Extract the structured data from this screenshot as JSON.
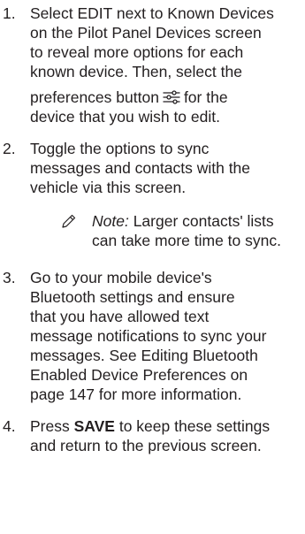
{
  "steps": [
    {
      "number": "1.",
      "lines": [
        "Select EDIT next to Known Devices",
        "on the Pilot Panel Devices screen",
        "to reveal more options for each",
        "known device. Then, select the"
      ],
      "line5_before": "preferences button",
      "line5_after": "for the",
      "line6": "device that you wish to edit."
    },
    {
      "number": "2.",
      "lines": [
        "Toggle the options to sync",
        "messages and contacts with the",
        "vehicle via this screen."
      ]
    },
    {
      "number": "3.",
      "lines": [
        "Go to your mobile device's",
        "Bluetooth settings and ensure",
        "that you have allowed text",
        "message notifications to sync your",
        "messages. See Editing Bluetooth",
        "Enabled Device Preferences on",
        "page 147 for more information."
      ]
    },
    {
      "number": "4.",
      "press": "Press",
      "save": "SAVE",
      "line1_rest": "to keep these settings",
      "line2": "and return to the previous screen."
    }
  ],
  "note": {
    "label": "Note:",
    "line1_rest": "Larger contacts' lists",
    "line2": "can take more time to sync."
  },
  "icons": {
    "note": "pencil-icon",
    "preferences": "sliders-icon"
  }
}
